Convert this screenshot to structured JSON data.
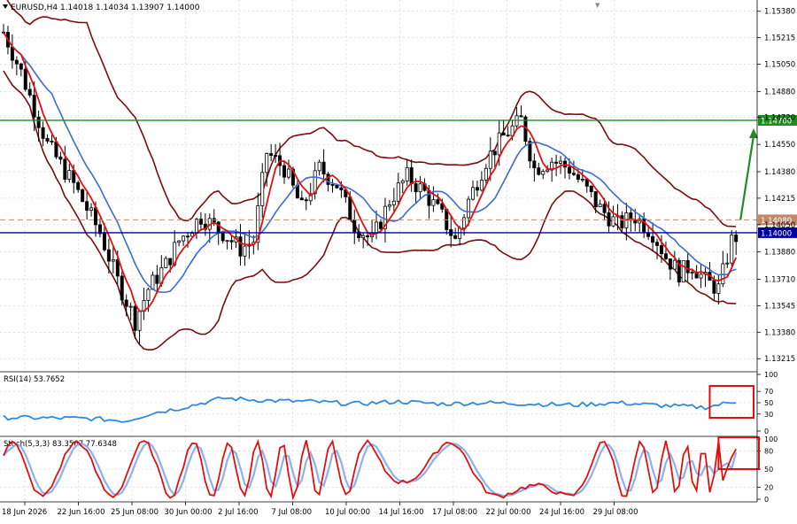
{
  "symbol_title": "EURUSD,H4  1.14018 1.14034 1.13907 1.14000",
  "colors": {
    "background": "#ffffff",
    "grid": "#c8d2dc",
    "candle": "#000000",
    "bollinger": "#7a0d0d",
    "ma_fast": "#e01010",
    "ma_slow": "#3a6fd8",
    "resistance_line": "#1e8c1e",
    "current_line": "#0000a0",
    "dashed_level": "#c08a6a",
    "forecast_arrow": "#1e8c1e",
    "rsi_line": "#2e8ae0",
    "stoch_main": "#e01010",
    "stoch_signal": "#8fb0ee",
    "highlight_box": "#e01010"
  },
  "chart_data": [
    {
      "type": "candlestick",
      "panel": "main",
      "title": "EURUSD,H4  1.14018 1.14034 1.13907 1.14000",
      "ylim": [
        1.1315,
        1.1545
      ],
      "y_ticks": [
        "1.15380",
        "1.15215",
        "1.15050",
        "1.14880",
        "1.14720",
        "1.14550",
        "1.14380",
        "1.14215",
        "1.14050",
        "1.13880",
        "1.13710",
        "1.13545",
        "1.13380",
        "1.13215"
      ],
      "x_tick_labels": [
        "18 Jun 2026",
        "22 Jun 16:00",
        "25 Jun 08:00",
        "30 Jun 00:00",
        "2 Jul 16:00",
        "7 Jul 08:00",
        "10 Jul 00:00",
        "14 Jul 16:00",
        "17 Jul 08:00",
        "22 Jul 00:00",
        "24 Jul 16:00",
        "29 Jul 08:00"
      ],
      "price_anchors": [
        [
          0,
          1.1525
        ],
        [
          4,
          1.15
        ],
        [
          10,
          1.1455
        ],
        [
          16,
          1.143
        ],
        [
          22,
          1.14
        ],
        [
          26,
          1.137
        ],
        [
          30,
          1.1345
        ],
        [
          33,
          1.1365
        ],
        [
          37,
          1.138
        ],
        [
          40,
          1.1395
        ],
        [
          45,
          1.141
        ],
        [
          50,
          1.14
        ],
        [
          54,
          1.139
        ],
        [
          57,
          1.1395
        ],
        [
          60,
          1.145
        ],
        [
          64,
          1.144
        ],
        [
          68,
          1.1415
        ],
        [
          72,
          1.144
        ],
        [
          76,
          1.143
        ],
        [
          80,
          1.1405
        ],
        [
          84,
          1.1395
        ],
        [
          88,
          1.142
        ],
        [
          92,
          1.1435
        ],
        [
          96,
          1.1425
        ],
        [
          100,
          1.141
        ],
        [
          103,
          1.1395
        ],
        [
          106,
          1.142
        ],
        [
          110,
          1.1445
        ],
        [
          114,
          1.146
        ],
        [
          118,
          1.147
        ],
        [
          121,
          1.144
        ],
        [
          125,
          1.1445
        ],
        [
          129,
          1.144
        ],
        [
          132,
          1.143
        ],
        [
          136,
          1.1415
        ],
        [
          140,
          1.1405
        ],
        [
          144,
          1.141
        ],
        [
          148,
          1.14
        ],
        [
          151,
          1.1385
        ],
        [
          154,
          1.1375
        ],
        [
          157,
          1.138
        ],
        [
          160,
          1.137
        ],
        [
          163,
          1.1365
        ],
        [
          166,
          1.1395
        ],
        [
          168,
          1.14
        ]
      ],
      "series": [
        {
          "name": "Bollinger Bands",
          "role": "bands"
        },
        {
          "name": "MA fast",
          "role": "fast"
        },
        {
          "name": "MA slow",
          "role": "slow"
        }
      ],
      "levels": [
        {
          "name": "resistance",
          "value": 1.147,
          "label": "1.14700",
          "style": "solid"
        },
        {
          "name": "target",
          "value": 1.1408,
          "label": "1.14080",
          "style": "dashed"
        },
        {
          "name": "current",
          "value": 1.14,
          "label": "1.14000",
          "style": "solid"
        }
      ],
      "annotations": [
        {
          "type": "arrow",
          "from": [
            168,
            1.1408
          ],
          "to": [
            171,
            1.1465
          ]
        }
      ]
    },
    {
      "type": "line",
      "panel": "rsi",
      "title": "RSI(14) 53.7652",
      "ylim": [
        0,
        100
      ],
      "y_ticks": [
        "100",
        "70",
        "50",
        "30",
        "0"
      ],
      "anchors": [
        [
          0,
          24
        ],
        [
          20,
          22
        ],
        [
          28,
          18
        ],
        [
          34,
          32
        ],
        [
          40,
          40
        ],
        [
          50,
          58
        ],
        [
          60,
          54
        ],
        [
          70,
          52
        ],
        [
          80,
          48
        ],
        [
          90,
          52
        ],
        [
          100,
          48
        ],
        [
          110,
          50
        ],
        [
          120,
          48
        ],
        [
          130,
          46
        ],
        [
          140,
          50
        ],
        [
          150,
          45
        ],
        [
          160,
          42
        ],
        [
          168,
          54
        ]
      ],
      "highlight_box_x": [
        161,
        171
      ]
    },
    {
      "type": "line",
      "panel": "stochastic",
      "title": "Stoch(5,3,3) 83.3567 77.6348",
      "ylim": [
        0,
        100
      ],
      "y_ticks": [
        "100",
        "80",
        "50",
        "20",
        "0"
      ],
      "main_value": 83.3567,
      "signal_value": 77.6348,
      "highlight_box_x": [
        163,
        171
      ]
    }
  ]
}
